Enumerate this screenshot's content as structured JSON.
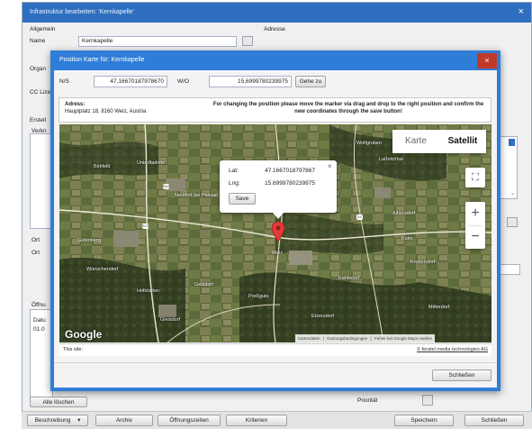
{
  "bg": {
    "title": "Infrastruktur bearbeiten: 'Kernkapelle'",
    "close": "×",
    "tab_allgemein": "Allgemein",
    "tab_adresse": "Adresse",
    "name_label": "Name",
    "name_value": "Kernkapelle",
    "organisation_label": "Organ",
    "cc_label": "CC Lizen",
    "erstellt_label": "Erstell",
    "verkn_label": "Verkn",
    "ort_label1": "Ort",
    "ort_label2": "Ort",
    "oeffnung_label": "Öffnu",
    "daten_label": "Datu",
    "daten_value": "01.0",
    "alle_loeschen": "Alle löschen",
    "prioritaet": "Priorität"
  },
  "modal": {
    "title": "Position Karte für: Kernkapelle",
    "close": "×",
    "ns_label": "N/S",
    "ns_value": "47,16670187978670",
    "wo_label": "W/O",
    "wo_value": "15,6999780239975",
    "goto_button": "Gehe zu",
    "adress_label": "Adress:",
    "adress_value": "Hauptplatz 18, 8160 Weiz, Austria",
    "instruction": "For changing the position please move the marker via drag and drop to the right position and confirm the new coordinates through the save button!",
    "this_site": "This site:",
    "copyright": "© feratel media technologies AG",
    "close_button": "Schließen"
  },
  "map": {
    "karte": "Karte",
    "satellit": "Satellit",
    "zoom_in": "+",
    "zoom_out": "−",
    "fullscreen": "⛶",
    "google": "Google",
    "attribution": [
      "Kartendaten",
      "Nutzungsbedingungen",
      "Fehler bei Google Maps melden"
    ],
    "popup": {
      "lat_label": "Lat:",
      "lat_value": "47.1667018797867",
      "lng_label": "Lng:",
      "lng_value": "15.6999780239975",
      "save": "Save",
      "close": "×"
    },
    "places": [
      "Birkfeld",
      "Unterfladnitz",
      "Neudorf bei Passail",
      "Gutenberg",
      "Gleisdorf",
      "Laßnitzthal",
      "Weiz",
      "Albersdorf",
      "Krottendorf",
      "Etzersdorf",
      "Wolfgruben",
      "Gelsdorf",
      "Preßguts",
      "Mitterdorf",
      "Hofstätten",
      "Kulm",
      "Wünschendorf",
      "Kahlsdorf"
    ],
    "roads": [
      "B64",
      "B72",
      "A2"
    ]
  },
  "toolbar": {
    "beschreibung": "Beschreibung",
    "archiv": "Archiv",
    "oeffnungszeiten": "Öffnungszeiten",
    "kriterien": "Kriterien",
    "speichern": "Speichern",
    "schliessen": "Schließen"
  }
}
